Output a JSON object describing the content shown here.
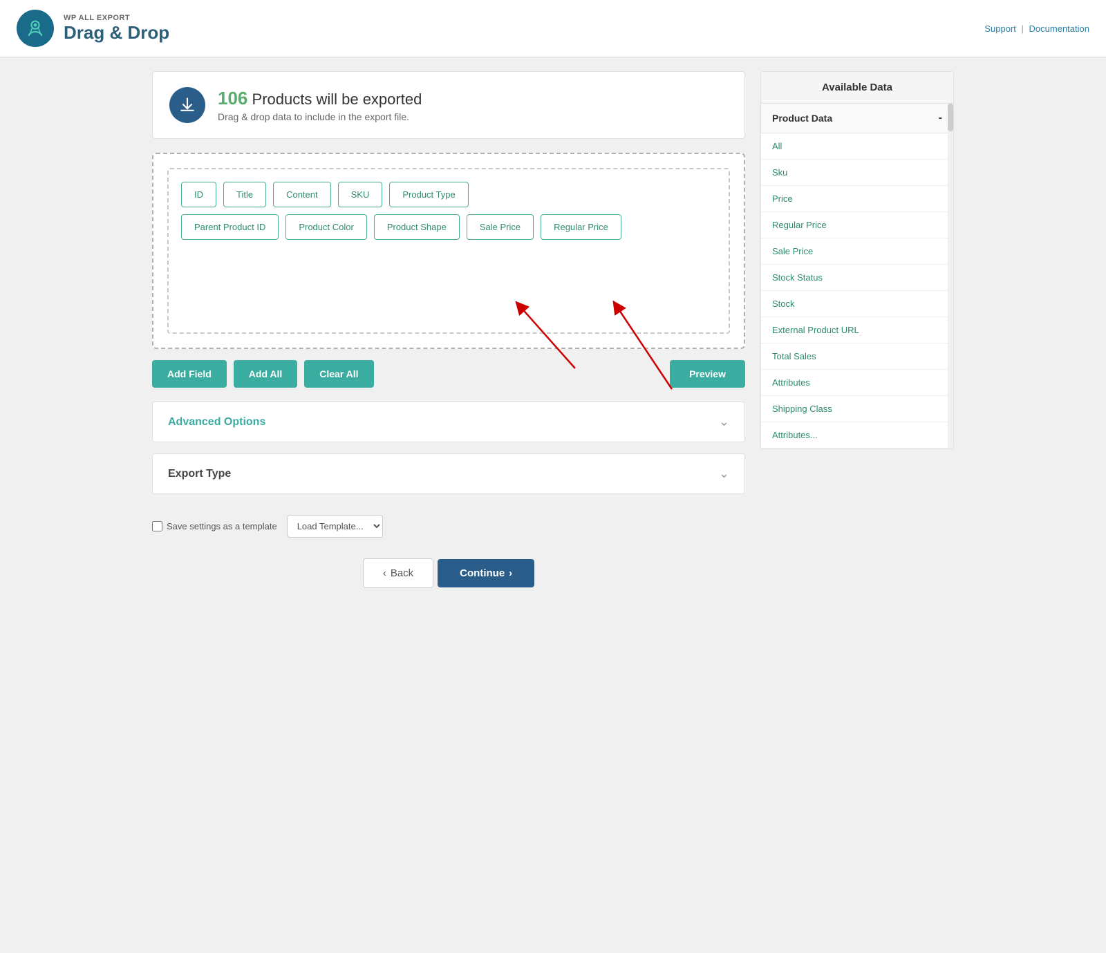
{
  "header": {
    "plugin_name": "WP ALL EXPORT",
    "title": "Drag & Drop",
    "support_label": "Support",
    "docs_label": "Documentation"
  },
  "banner": {
    "count": "106",
    "count_text": "Products will be exported",
    "subtitle": "Drag & drop data to include in the export file."
  },
  "fields": {
    "row1": [
      "ID",
      "Title",
      "Content",
      "SKU",
      "Product Type"
    ],
    "row2": [
      "Parent Product ID",
      "Product Color",
      "Product Shape",
      "Sale Price",
      "Regular Price"
    ]
  },
  "buttons": {
    "add_field": "Add Field",
    "add_all": "Add All",
    "clear_all": "Clear All",
    "preview": "Preview"
  },
  "advanced_options": {
    "label": "Advanced Options"
  },
  "export_type": {
    "label": "Export Type"
  },
  "footer": {
    "save_label": "Save settings as a template",
    "load_placeholder": "Load Template..."
  },
  "nav": {
    "back": "Back",
    "continue": "Continue"
  },
  "available_data": {
    "header": "Available Data",
    "section_label": "Product Data",
    "collapse_icon": "-",
    "items": [
      "All",
      "Sku",
      "Price",
      "Regular Price",
      "Sale Price",
      "Stock Status",
      "Stock",
      "External Product URL",
      "Total Sales",
      "Attributes",
      "Shipping Class",
      "Attributes..."
    ]
  }
}
